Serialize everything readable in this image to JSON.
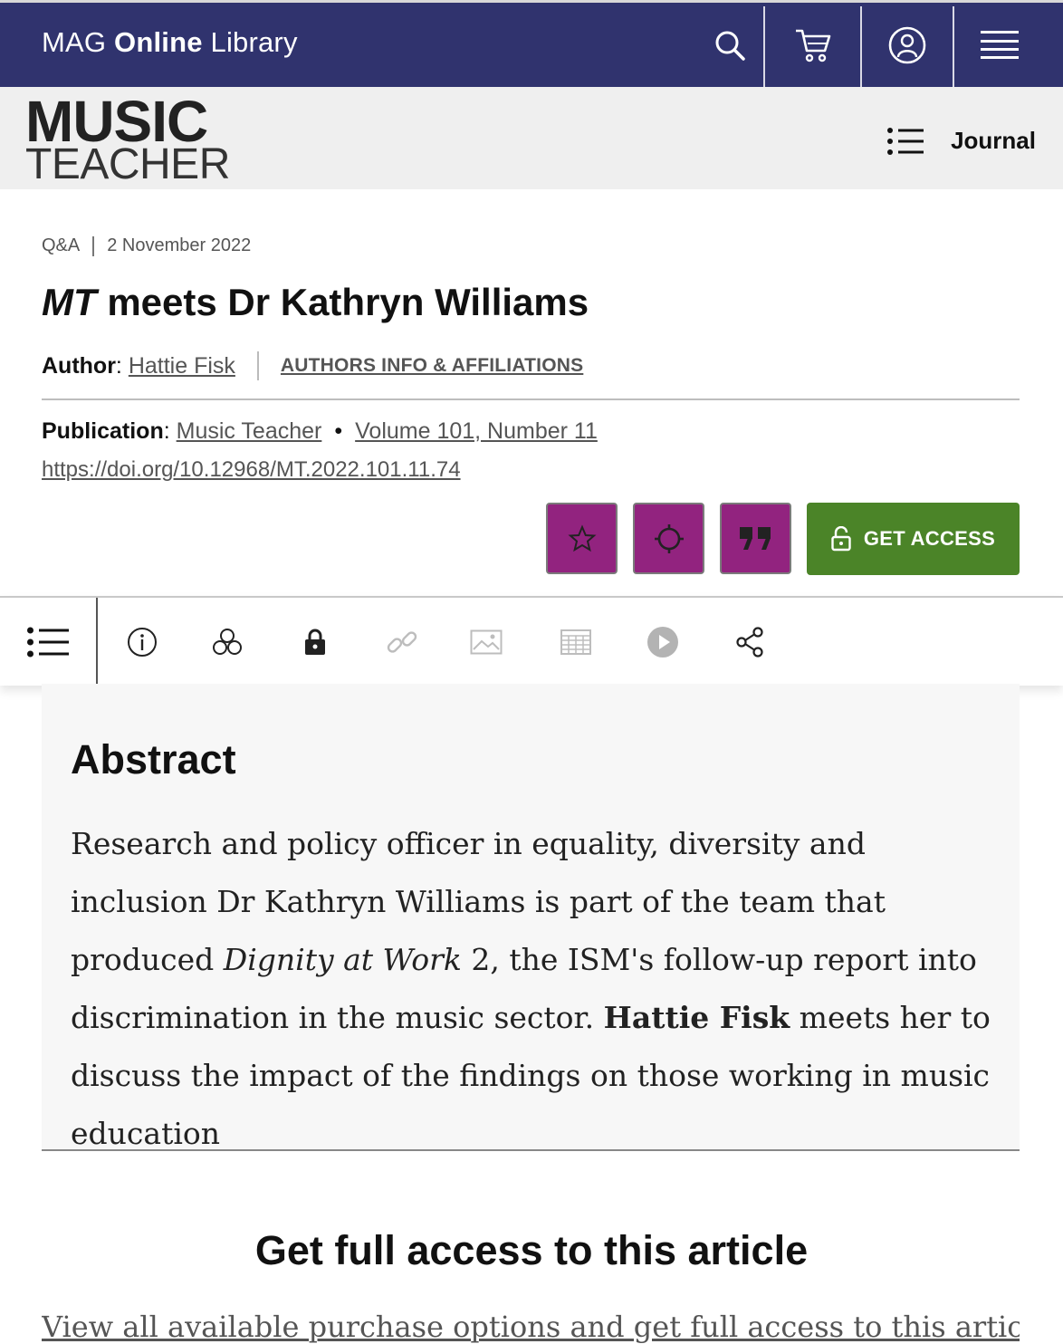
{
  "header": {
    "brand_prefix": "MAG ",
    "brand_bold": "Online",
    "brand_suffix": " Library",
    "icons": [
      "search-icon",
      "cart-icon",
      "user-icon",
      "menu-icon"
    ],
    "bg_color": "#30336e"
  },
  "journal_bar": {
    "logo_line1": "MUSIC",
    "logo_line2": "TEACHER",
    "journal_label": "Journal"
  },
  "article": {
    "type": "Q&A",
    "date": "2 November 2022",
    "title_italic": "MT",
    "title_rest": " meets Dr Kathryn Williams",
    "author_label": "Author",
    "author_name": "Hattie Fisk",
    "affiliations_label": "AUTHORS INFO & AFFILIATIONS",
    "publication_label": "Publication",
    "publication_name": "Music Teacher",
    "volume": "Volume 101, Number 11",
    "doi": "https://doi.org/10.12968/MT.2022.101.11.74"
  },
  "actions": {
    "buttons": [
      "favorite-star-icon",
      "track-citations-icon",
      "cite-quote-icon"
    ],
    "get_access_label": "GET ACCESS",
    "accent_color": "#92237f",
    "access_color": "#4b8428"
  },
  "toolbar": {
    "icons": [
      "contents-list-icon",
      "info-icon",
      "metrics-icon",
      "lock-icon",
      "link-icon",
      "image-icon",
      "table-icon",
      "play-icon",
      "share-icon"
    ]
  },
  "abstract": {
    "heading": "Abstract",
    "text_1": "Research and policy officer in equality, diversity and inclusion Dr Kathryn Williams is part of the team that produced ",
    "text_italic": "Dignity at Work",
    "text_2": " 2, the ISM's follow-up report into discrimination in the music sector. ",
    "text_bold": "Hattie Fisk",
    "text_3": " meets her to discuss the impact of the findings on those working in music education"
  },
  "access_section": {
    "heading": "Get full access to this article",
    "subtext": "View all available purchase options and get full access to this article."
  }
}
